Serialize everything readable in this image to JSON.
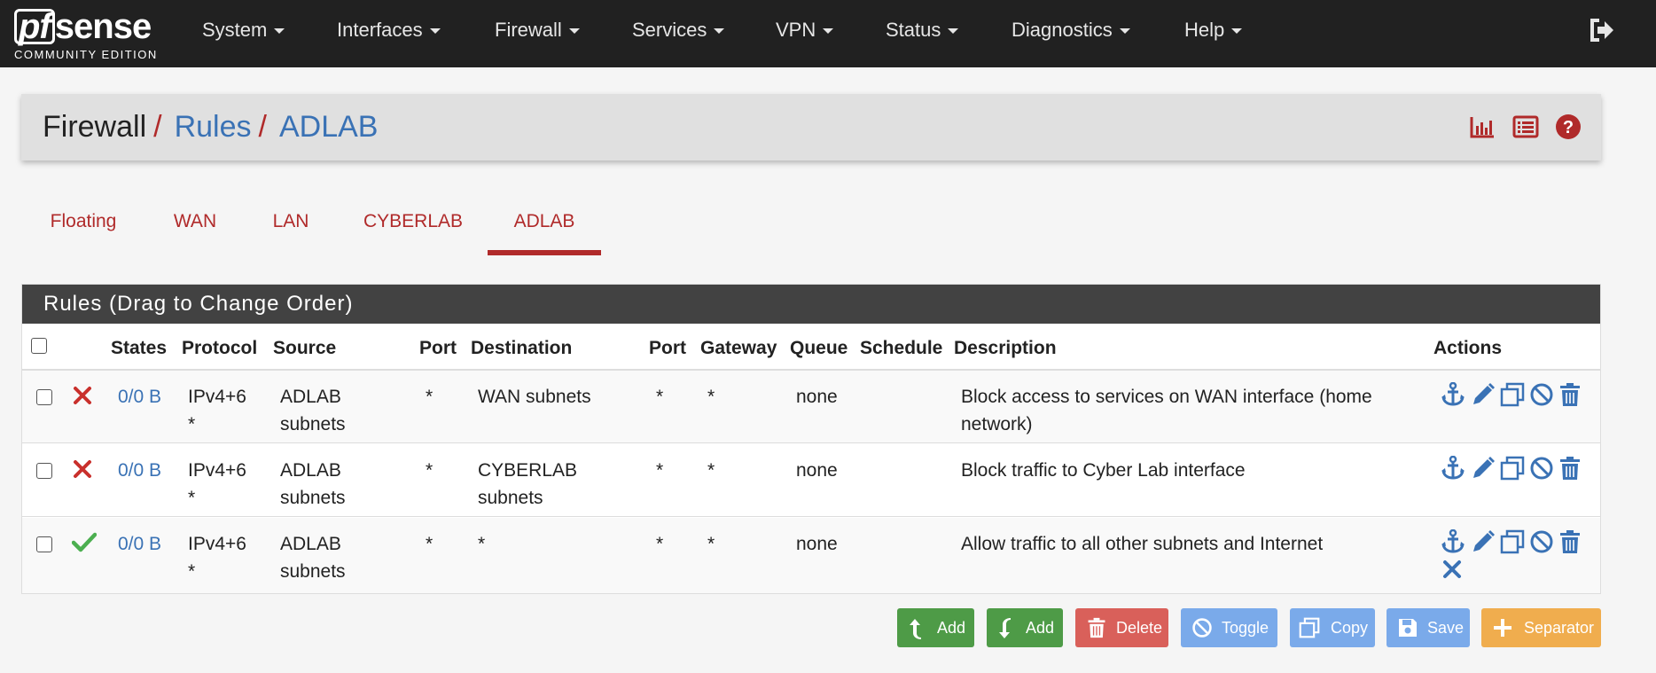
{
  "logo": {
    "mark_pf": "pf",
    "mark_rest": "sense",
    "edition": "COMMUNITY EDITION"
  },
  "nav": {
    "items": [
      {
        "label": "System"
      },
      {
        "label": "Interfaces"
      },
      {
        "label": "Firewall"
      },
      {
        "label": "Services"
      },
      {
        "label": "VPN"
      },
      {
        "label": "Status"
      },
      {
        "label": "Diagnostics"
      },
      {
        "label": "Help"
      }
    ]
  },
  "breadcrumb": {
    "root": "Firewall",
    "sep": "/",
    "level2": "Rules",
    "level3": "ADLAB"
  },
  "tabs": [
    {
      "label": "Floating"
    },
    {
      "label": "WAN"
    },
    {
      "label": "LAN"
    },
    {
      "label": "CYBERLAB"
    },
    {
      "label": "ADLAB"
    }
  ],
  "panel": {
    "title": "Rules (Drag to Change Order)"
  },
  "table": {
    "headers": {
      "states": "States",
      "protocol": "Protocol",
      "source": "Source",
      "port": "Port",
      "destination": "Destination",
      "dport": "Port",
      "gateway": "Gateway",
      "queue": "Queue",
      "schedule": "Schedule",
      "description": "Description",
      "actions": "Actions"
    },
    "rows": [
      {
        "action": "block",
        "states": "0/0 B",
        "protocol_l1": "IPv4+6",
        "protocol_l2": "*",
        "source_l1": "ADLAB",
        "source_l2": "subnets",
        "port": "*",
        "destination_l1": "WAN subnets",
        "destination_l2": "",
        "dport": "*",
        "gateway": "*",
        "queue": "none",
        "schedule": "",
        "description_l1": "Block access to services on WAN interface (home",
        "description_l2": "network)"
      },
      {
        "action": "block",
        "states": "0/0 B",
        "protocol_l1": "IPv4+6",
        "protocol_l2": "*",
        "source_l1": "ADLAB",
        "source_l2": "subnets",
        "port": "*",
        "destination_l1": "CYBERLAB",
        "destination_l2": "subnets",
        "dport": "*",
        "gateway": "*",
        "queue": "none",
        "schedule": "",
        "description_l1": "Block traffic to Cyber Lab interface",
        "description_l2": ""
      },
      {
        "action": "pass",
        "states": "0/0 B",
        "protocol_l1": "IPv4+6",
        "protocol_l2": "*",
        "source_l1": "ADLAB",
        "source_l2": "subnets",
        "port": "*",
        "destination_l1": "*",
        "destination_l2": "",
        "dport": "*",
        "gateway": "*",
        "queue": "none",
        "schedule": "",
        "description_l1": "Allow traffic to all other subnets and Internet",
        "description_l2": ""
      }
    ]
  },
  "buttons": {
    "add_top": "Add",
    "add_bottom": "Add",
    "delete": "Delete",
    "toggle": "Toggle",
    "copy": "Copy",
    "save": "Save",
    "separator": "Separator"
  },
  "colors": {
    "navbar": "#212121",
    "accent_red": "#b02a2a",
    "link_blue": "#3a72b5",
    "success_green": "#4e9b47",
    "danger_red": "#d9605a",
    "info_blue": "#7aaaea",
    "warning_orange": "#f0ad4e"
  }
}
